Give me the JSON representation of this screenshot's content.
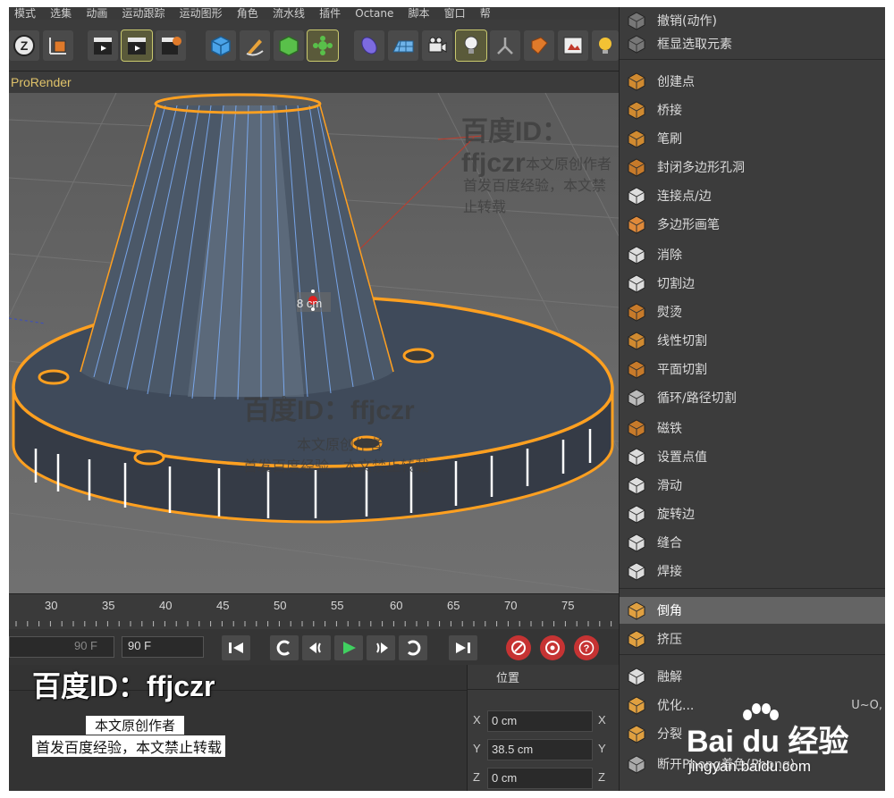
{
  "menubar": [
    "模式",
    "选集",
    "动画",
    "运动跟踪",
    "运动图形",
    "角色",
    "流水线",
    "插件",
    "Octane",
    "脚本",
    "窗口",
    "帮"
  ],
  "viewport_header": "ProRender",
  "viewport": {
    "object_label": "8 cm"
  },
  "timeline": {
    "ticks": [
      "30",
      "35",
      "40",
      "45",
      "50",
      "55",
      "60",
      "65",
      "70",
      "75"
    ]
  },
  "playback": {
    "end_frame_value": "90 F",
    "max_frame_value": "90 F"
  },
  "coords": {
    "header": "位置",
    "rows": [
      {
        "axis": "X",
        "value": "0 cm",
        "axis2": "X"
      },
      {
        "axis": "Y",
        "value": "38.5 cm",
        "axis2": "Y"
      },
      {
        "axis": "Z",
        "value": "0 cm",
        "axis2": "Z"
      }
    ]
  },
  "context_menu": {
    "items": [
      {
        "label": "撤销(动作)",
        "icon": "undo-icon"
      },
      {
        "label": "框显选取元素",
        "icon": "frame-selection-icon"
      },
      {
        "label": "创建点",
        "icon": "create-point-icon"
      },
      {
        "label": "桥接",
        "icon": "bridge-icon"
      },
      {
        "label": "笔刷",
        "icon": "brush-icon"
      },
      {
        "label": "封闭多边形孔洞",
        "icon": "close-polygon-hole-icon"
      },
      {
        "label": "连接点/边",
        "icon": "connect-icon"
      },
      {
        "label": "多边形画笔",
        "icon": "polygon-pen-icon"
      },
      {
        "label": "消除",
        "icon": "dissolve-icon"
      },
      {
        "label": "切割边",
        "icon": "edge-cut-icon"
      },
      {
        "label": "熨烫",
        "icon": "iron-icon"
      },
      {
        "label": "线性切割",
        "icon": "line-cut-icon"
      },
      {
        "label": "平面切割",
        "icon": "plane-cut-icon"
      },
      {
        "label": "循环/路径切割",
        "icon": "loop-cut-icon"
      },
      {
        "label": "磁铁",
        "icon": "magnet-icon"
      },
      {
        "label": "设置点值",
        "icon": "set-point-value-icon"
      },
      {
        "label": "滑动",
        "icon": "slide-icon"
      },
      {
        "label": "旋转边",
        "icon": "spin-edge-icon"
      },
      {
        "label": "缝合",
        "icon": "stitch-icon"
      },
      {
        "label": "焊接",
        "icon": "weld-icon"
      },
      {
        "label": "倒角",
        "icon": "bevel-icon"
      },
      {
        "label": "挤压",
        "icon": "extrude-icon"
      },
      {
        "label": "融解",
        "icon": "melt-icon"
      },
      {
        "label": "优化...",
        "icon": "optimize-icon",
        "shortcut": "U~O,"
      },
      {
        "label": "分裂",
        "icon": "split-icon"
      },
      {
        "label": "断开Phong着色(Phong)",
        "icon": "break-phong-icon"
      }
    ]
  },
  "watermark": {
    "title": "百度ID：ffjczr",
    "line1": "本文原创作者",
    "line2": "首发百度经验，本文禁止转载",
    "brand": "Bai du 经验",
    "url": "jingyan.baidu.com"
  }
}
